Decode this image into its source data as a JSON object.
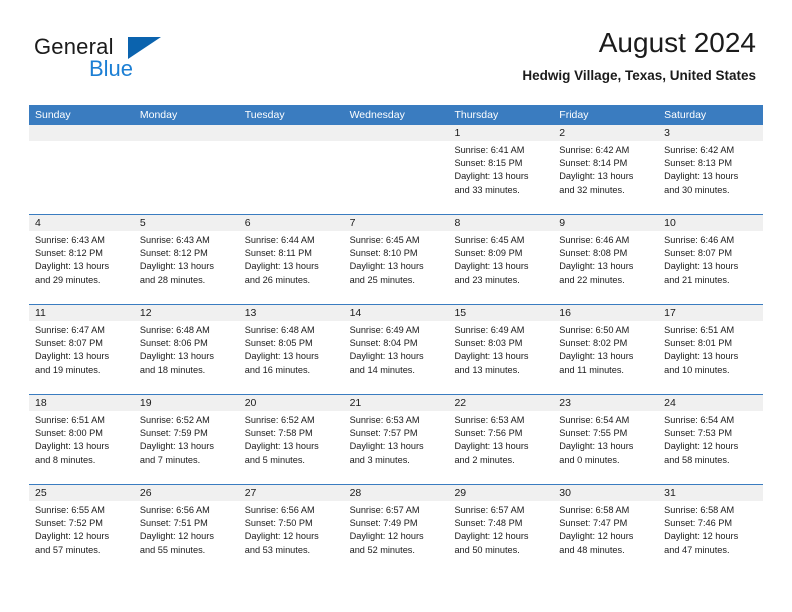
{
  "brand": {
    "name_top": "General",
    "name_bottom": "Blue",
    "triangle_color": "#0b63ae",
    "blue_color": "#1c7fd4"
  },
  "header": {
    "title": "August 2024",
    "subtitle": "Hedwig Village, Texas, United States"
  },
  "theme": {
    "header_blue": "#3a7cc0",
    "row_band_gray": "#f0f0f0",
    "text_color": "#1b1b1b"
  },
  "calendar": {
    "day_headers": [
      "Sunday",
      "Monday",
      "Tuesday",
      "Wednesday",
      "Thursday",
      "Friday",
      "Saturday"
    ],
    "weeks": [
      [
        {
          "day": "",
          "lines": []
        },
        {
          "day": "",
          "lines": []
        },
        {
          "day": "",
          "lines": []
        },
        {
          "day": "",
          "lines": []
        },
        {
          "day": "1",
          "lines": [
            "Sunrise: 6:41 AM",
            "Sunset: 8:15 PM",
            "Daylight: 13 hours",
            "and 33 minutes."
          ]
        },
        {
          "day": "2",
          "lines": [
            "Sunrise: 6:42 AM",
            "Sunset: 8:14 PM",
            "Daylight: 13 hours",
            "and 32 minutes."
          ]
        },
        {
          "day": "3",
          "lines": [
            "Sunrise: 6:42 AM",
            "Sunset: 8:13 PM",
            "Daylight: 13 hours",
            "and 30 minutes."
          ]
        }
      ],
      [
        {
          "day": "4",
          "lines": [
            "Sunrise: 6:43 AM",
            "Sunset: 8:12 PM",
            "Daylight: 13 hours",
            "and 29 minutes."
          ]
        },
        {
          "day": "5",
          "lines": [
            "Sunrise: 6:43 AM",
            "Sunset: 8:12 PM",
            "Daylight: 13 hours",
            "and 28 minutes."
          ]
        },
        {
          "day": "6",
          "lines": [
            "Sunrise: 6:44 AM",
            "Sunset: 8:11 PM",
            "Daylight: 13 hours",
            "and 26 minutes."
          ]
        },
        {
          "day": "7",
          "lines": [
            "Sunrise: 6:45 AM",
            "Sunset: 8:10 PM",
            "Daylight: 13 hours",
            "and 25 minutes."
          ]
        },
        {
          "day": "8",
          "lines": [
            "Sunrise: 6:45 AM",
            "Sunset: 8:09 PM",
            "Daylight: 13 hours",
            "and 23 minutes."
          ]
        },
        {
          "day": "9",
          "lines": [
            "Sunrise: 6:46 AM",
            "Sunset: 8:08 PM",
            "Daylight: 13 hours",
            "and 22 minutes."
          ]
        },
        {
          "day": "10",
          "lines": [
            "Sunrise: 6:46 AM",
            "Sunset: 8:07 PM",
            "Daylight: 13 hours",
            "and 21 minutes."
          ]
        }
      ],
      [
        {
          "day": "11",
          "lines": [
            "Sunrise: 6:47 AM",
            "Sunset: 8:07 PM",
            "Daylight: 13 hours",
            "and 19 minutes."
          ]
        },
        {
          "day": "12",
          "lines": [
            "Sunrise: 6:48 AM",
            "Sunset: 8:06 PM",
            "Daylight: 13 hours",
            "and 18 minutes."
          ]
        },
        {
          "day": "13",
          "lines": [
            "Sunrise: 6:48 AM",
            "Sunset: 8:05 PM",
            "Daylight: 13 hours",
            "and 16 minutes."
          ]
        },
        {
          "day": "14",
          "lines": [
            "Sunrise: 6:49 AM",
            "Sunset: 8:04 PM",
            "Daylight: 13 hours",
            "and 14 minutes."
          ]
        },
        {
          "day": "15",
          "lines": [
            "Sunrise: 6:49 AM",
            "Sunset: 8:03 PM",
            "Daylight: 13 hours",
            "and 13 minutes."
          ]
        },
        {
          "day": "16",
          "lines": [
            "Sunrise: 6:50 AM",
            "Sunset: 8:02 PM",
            "Daylight: 13 hours",
            "and 11 minutes."
          ]
        },
        {
          "day": "17",
          "lines": [
            "Sunrise: 6:51 AM",
            "Sunset: 8:01 PM",
            "Daylight: 13 hours",
            "and 10 minutes."
          ]
        }
      ],
      [
        {
          "day": "18",
          "lines": [
            "Sunrise: 6:51 AM",
            "Sunset: 8:00 PM",
            "Daylight: 13 hours",
            "and 8 minutes."
          ]
        },
        {
          "day": "19",
          "lines": [
            "Sunrise: 6:52 AM",
            "Sunset: 7:59 PM",
            "Daylight: 13 hours",
            "and 7 minutes."
          ]
        },
        {
          "day": "20",
          "lines": [
            "Sunrise: 6:52 AM",
            "Sunset: 7:58 PM",
            "Daylight: 13 hours",
            "and 5 minutes."
          ]
        },
        {
          "day": "21",
          "lines": [
            "Sunrise: 6:53 AM",
            "Sunset: 7:57 PM",
            "Daylight: 13 hours",
            "and 3 minutes."
          ]
        },
        {
          "day": "22",
          "lines": [
            "Sunrise: 6:53 AM",
            "Sunset: 7:56 PM",
            "Daylight: 13 hours",
            "and 2 minutes."
          ]
        },
        {
          "day": "23",
          "lines": [
            "Sunrise: 6:54 AM",
            "Sunset: 7:55 PM",
            "Daylight: 13 hours",
            "and 0 minutes."
          ]
        },
        {
          "day": "24",
          "lines": [
            "Sunrise: 6:54 AM",
            "Sunset: 7:53 PM",
            "Daylight: 12 hours",
            "and 58 minutes."
          ]
        }
      ],
      [
        {
          "day": "25",
          "lines": [
            "Sunrise: 6:55 AM",
            "Sunset: 7:52 PM",
            "Daylight: 12 hours",
            "and 57 minutes."
          ]
        },
        {
          "day": "26",
          "lines": [
            "Sunrise: 6:56 AM",
            "Sunset: 7:51 PM",
            "Daylight: 12 hours",
            "and 55 minutes."
          ]
        },
        {
          "day": "27",
          "lines": [
            "Sunrise: 6:56 AM",
            "Sunset: 7:50 PM",
            "Daylight: 12 hours",
            "and 53 minutes."
          ]
        },
        {
          "day": "28",
          "lines": [
            "Sunrise: 6:57 AM",
            "Sunset: 7:49 PM",
            "Daylight: 12 hours",
            "and 52 minutes."
          ]
        },
        {
          "day": "29",
          "lines": [
            "Sunrise: 6:57 AM",
            "Sunset: 7:48 PM",
            "Daylight: 12 hours",
            "and 50 minutes."
          ]
        },
        {
          "day": "30",
          "lines": [
            "Sunrise: 6:58 AM",
            "Sunset: 7:47 PM",
            "Daylight: 12 hours",
            "and 48 minutes."
          ]
        },
        {
          "day": "31",
          "lines": [
            "Sunrise: 6:58 AM",
            "Sunset: 7:46 PM",
            "Daylight: 12 hours",
            "and 47 minutes."
          ]
        }
      ]
    ]
  }
}
